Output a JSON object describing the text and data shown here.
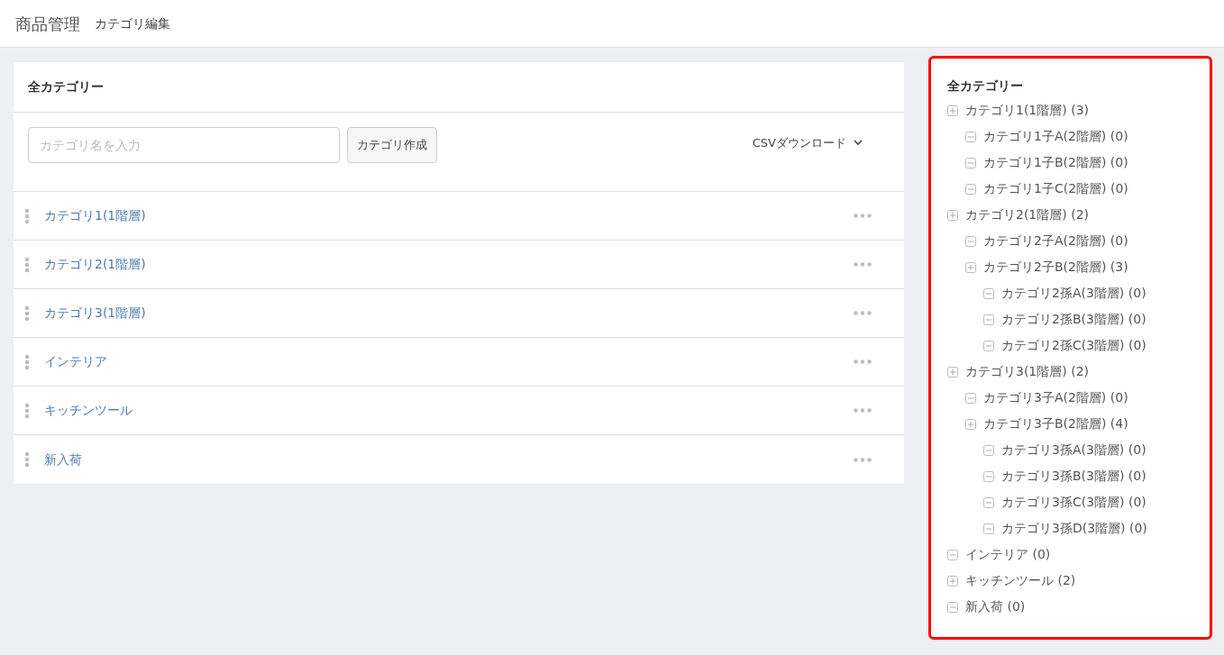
{
  "header": {
    "title": "商品管理",
    "subtitle": "カテゴリ編集"
  },
  "main_card": {
    "title": "全カテゴリー",
    "search": {
      "placeholder": "カテゴリ名を入力"
    },
    "create_button": "カテゴリ作成",
    "csv_download": "CSVダウンロード",
    "rows": [
      {
        "name": "カテゴリ1(1階層)"
      },
      {
        "name": "カテゴリ2(1階層)"
      },
      {
        "name": "カテゴリ3(1階層)"
      },
      {
        "name": "インテリア"
      },
      {
        "name": "キッチンツール"
      },
      {
        "name": "新入荷"
      }
    ]
  },
  "tree_panel": {
    "title": "全カテゴリー",
    "items": [
      {
        "label": "カテゴリ1(1階層) (3)",
        "kind": "plus",
        "children": [
          {
            "label": "カテゴリ1子A(2階層) (0)",
            "kind": "minus"
          },
          {
            "label": "カテゴリ1子B(2階層) (0)",
            "kind": "minus"
          },
          {
            "label": "カテゴリ1子C(2階層) (0)",
            "kind": "minus"
          }
        ]
      },
      {
        "label": "カテゴリ2(1階層) (2)",
        "kind": "plus",
        "children": [
          {
            "label": "カテゴリ2子A(2階層) (0)",
            "kind": "minus"
          },
          {
            "label": "カテゴリ2子B(2階層) (3)",
            "kind": "plus",
            "children": [
              {
                "label": "カテゴリ2孫A(3階層) (0)",
                "kind": "minus"
              },
              {
                "label": "カテゴリ2孫B(3階層) (0)",
                "kind": "minus"
              },
              {
                "label": "カテゴリ2孫C(3階層) (0)",
                "kind": "minus"
              }
            ]
          }
        ]
      },
      {
        "label": "カテゴリ3(1階層) (2)",
        "kind": "plus",
        "children": [
          {
            "label": "カテゴリ3子A(2階層) (0)",
            "kind": "minus"
          },
          {
            "label": "カテゴリ3子B(2階層) (4)",
            "kind": "plus",
            "children": [
              {
                "label": "カテゴリ3孫A(3階層) (0)",
                "kind": "minus"
              },
              {
                "label": "カテゴリ3孫B(3階層) (0)",
                "kind": "minus"
              },
              {
                "label": "カテゴリ3孫C(3階層) (0)",
                "kind": "minus"
              },
              {
                "label": "カテゴリ3孫D(3階層) (0)",
                "kind": "minus"
              }
            ]
          }
        ]
      },
      {
        "label": "インテリア (0)",
        "kind": "minus"
      },
      {
        "label": "キッチンツール (2)",
        "kind": "plus"
      },
      {
        "label": "新入荷 (0)",
        "kind": "minus"
      }
    ]
  }
}
